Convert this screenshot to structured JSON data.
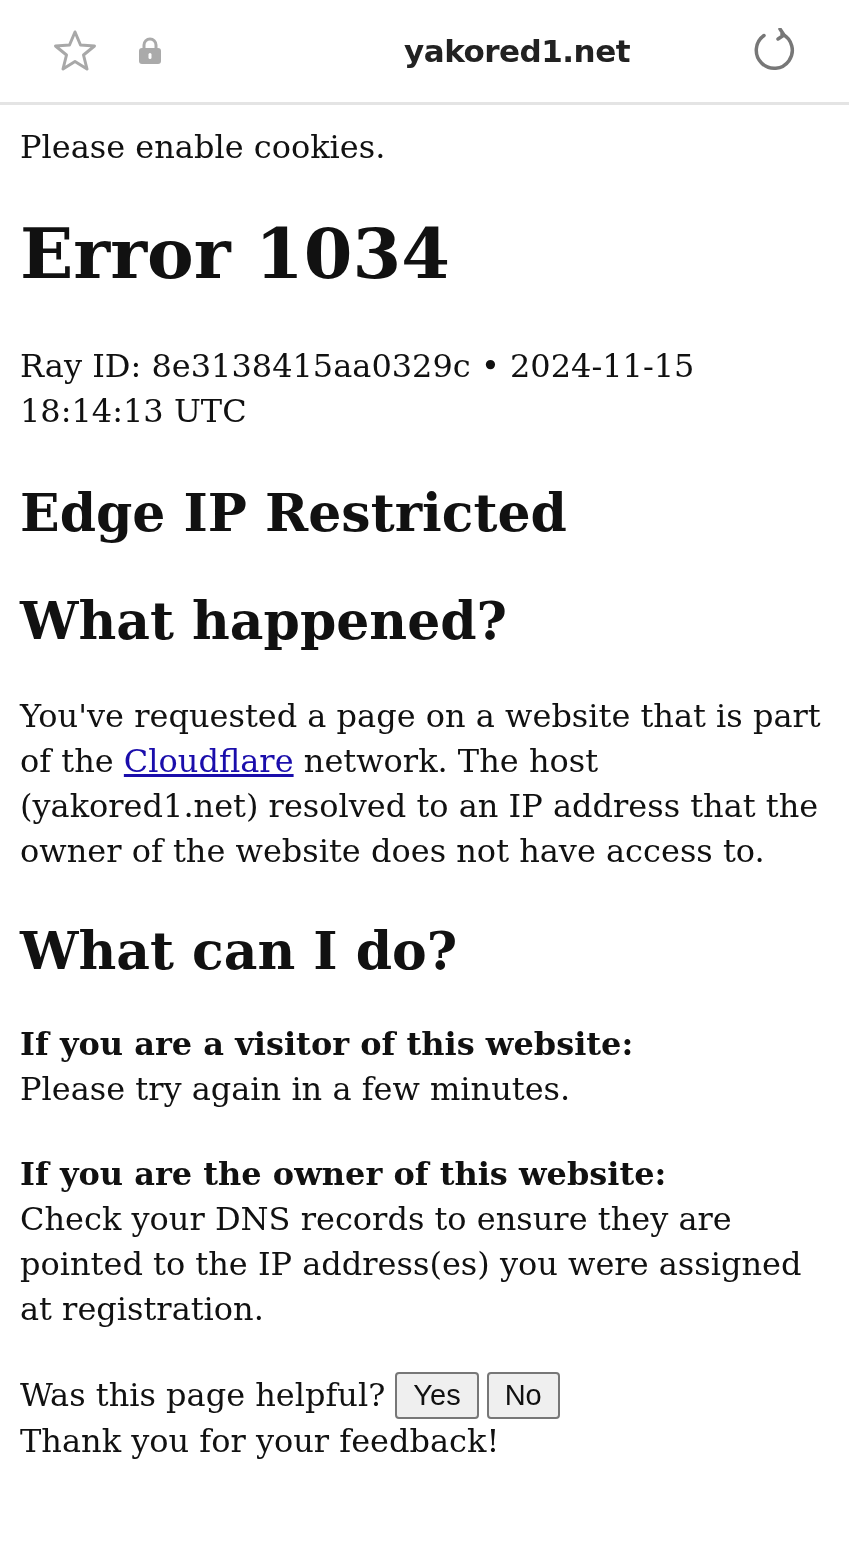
{
  "browser_bar": {
    "url": "yakored1.net"
  },
  "page": {
    "notice": "Please enable cookies.",
    "title": "Error 1034",
    "ray_info": "Ray ID: 8e3138415aa0329c • 2024-11-15 18:14:13 UTC",
    "subtitle": "Edge IP Restricted",
    "sections": [
      {
        "heading": "What happened?",
        "paragraph": {
          "before": "You've requested a page on a website that is part of the ",
          "link": "Cloudflare",
          "after": " network. The host (yakored1.net) resolved to an IP address that the owner of the website does not have access to."
        }
      },
      {
        "heading": "What can I do?",
        "items": [
          {
            "label": "If you are a visitor of this website:",
            "text": "Please try again in a few minutes."
          },
          {
            "label": "If you are the owner of this website:",
            "text": "Check your DNS records to ensure they are pointed to the IP address(es) you were assigned at registration."
          }
        ]
      }
    ],
    "feedback": {
      "question": "Was this page helpful?",
      "buttons": [
        "Yes",
        "No"
      ],
      "thanks": "Thank you for your feedback!"
    }
  }
}
